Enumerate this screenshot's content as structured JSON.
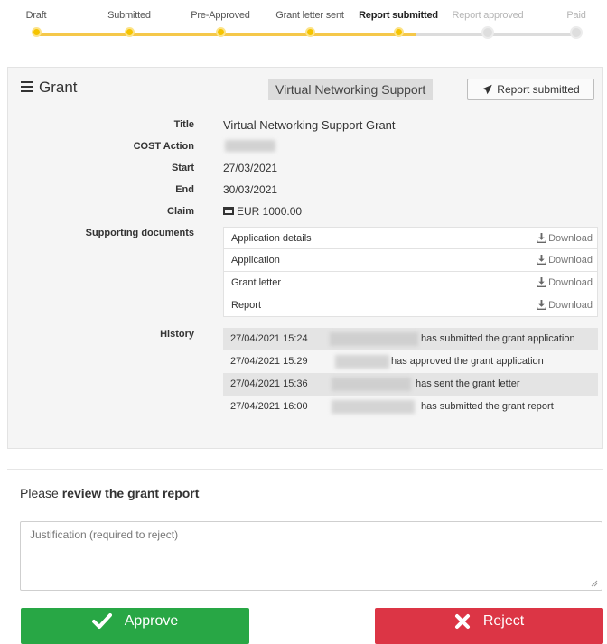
{
  "stepper": {
    "steps": [
      {
        "label": "Draft",
        "state": "done"
      },
      {
        "label": "Submitted",
        "state": "done"
      },
      {
        "label": "Pre-Approved",
        "state": "done"
      },
      {
        "label": "Grant letter sent",
        "state": "done"
      },
      {
        "label": "Report submitted",
        "state": "current"
      },
      {
        "label": "Report approved",
        "state": "todo"
      },
      {
        "label": "Paid",
        "state": "todo"
      }
    ]
  },
  "card": {
    "title": "Grant",
    "type_label": "Virtual Networking Support",
    "status_label": "Report submitted"
  },
  "fields": {
    "title_label": "Title",
    "title_value": "Virtual Networking Support Grant",
    "action_label": "COST Action",
    "start_label": "Start",
    "start_value": "27/03/2021",
    "end_label": "End",
    "end_value": "30/03/2021",
    "claim_label": "Claim",
    "claim_value": "EUR 1000.00",
    "docs_label": "Supporting documents",
    "history_label": "History"
  },
  "documents": [
    {
      "name": "Application details",
      "action": "Download"
    },
    {
      "name": "Application",
      "action": "Download"
    },
    {
      "name": "Grant letter",
      "action": "Download"
    },
    {
      "name": "Report",
      "action": "Download"
    }
  ],
  "history": [
    {
      "timestamp": "27/04/2021 15:24",
      "action": "has submitted the grant application"
    },
    {
      "timestamp": "27/04/2021 15:29",
      "action": "has approved the grant application"
    },
    {
      "timestamp": "27/04/2021 15:36",
      "action": "has sent the grant letter"
    },
    {
      "timestamp": "27/04/2021 16:00",
      "action": "has submitted the grant report"
    }
  ],
  "review": {
    "prefix": "Please",
    "emphasis": "review the grant report",
    "justification_placeholder": "Justification (required to reject)",
    "approve_label": "Approve",
    "reject_label": "Reject"
  },
  "colors": {
    "step_done": "#f5c400",
    "approve": "#28a745",
    "reject": "#dc3545"
  }
}
